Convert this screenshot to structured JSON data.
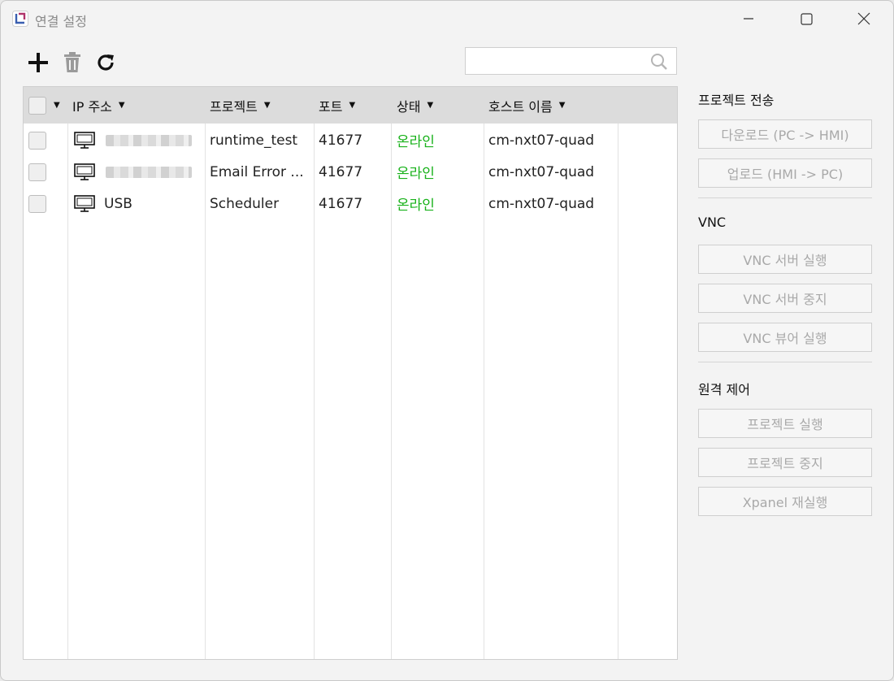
{
  "window": {
    "title": "연결 설정"
  },
  "search": {
    "placeholder": ""
  },
  "table": {
    "headers": {
      "ip": "IP 주소",
      "project": "프로젝트",
      "port": "포트",
      "status": "상태",
      "host": "호스트 이름"
    },
    "rows": [
      {
        "ip": "",
        "project": "runtime_test",
        "port": "41677",
        "status": "온라인",
        "host": "cm-nxt07-quad",
        "ip_hidden": true
      },
      {
        "ip": "",
        "project": "Email Error ...",
        "port": "41677",
        "status": "온라인",
        "host": "cm-nxt07-quad",
        "ip_hidden": true
      },
      {
        "ip": "USB",
        "project": "Scheduler",
        "port": "41677",
        "status": "온라인",
        "host": "cm-nxt07-quad",
        "ip_hidden": false
      }
    ]
  },
  "panel": {
    "transfer": {
      "title": "프로젝트 전송",
      "download": "다운로드 (PC -> HMI)",
      "upload": "업로드 (HMI -> PC)"
    },
    "vnc": {
      "title": "VNC",
      "server_start": "VNC 서버 실행",
      "server_stop": "VNC 서버 중지",
      "viewer_start": "VNC 뷰어 실행"
    },
    "remote": {
      "title": "원격 제어",
      "project_run": "프로젝트 실행",
      "project_stop": "프로젝트 중지",
      "xpanel_restart": "Xpanel 재실행"
    }
  },
  "colors": {
    "online": "#19b21b",
    "disabled_text": "#a9a9a9",
    "header_bg": "#dcdcdc"
  },
  "icons": [
    "app-icon",
    "minimize-icon",
    "maximize-icon",
    "close-icon",
    "add-icon",
    "trash-icon",
    "refresh-icon",
    "search-icon",
    "monitor-icon"
  ]
}
